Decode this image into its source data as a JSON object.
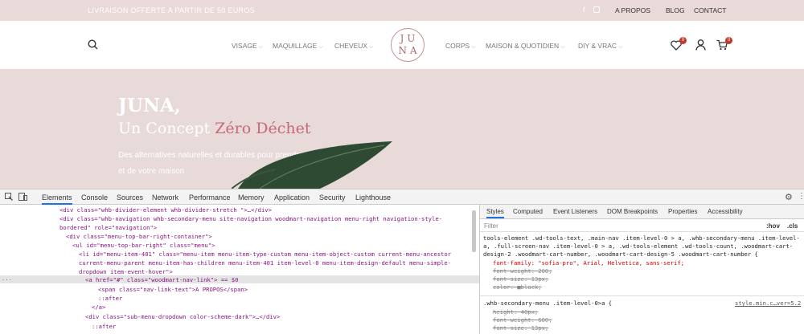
{
  "topbar": {
    "promo": "LIVRAISON OFFERTE A PARTIR DE 50 EUROS",
    "social": [
      "facebook-icon",
      "instagram-icon"
    ],
    "links": [
      "A PROPOS",
      "BLOG",
      "CONTACT"
    ]
  },
  "nav": {
    "left": [
      "VISAGE",
      "MAQUILLAGE",
      "CHEVEUX"
    ],
    "right": [
      "CORPS",
      "MAISON & QUOTIDIEN",
      "DIY & VRAC"
    ],
    "logo_line1": "J U",
    "logo_line2": "N A",
    "wishlist_count": "0",
    "cart_count": "0"
  },
  "hero": {
    "title": "JUNA,",
    "subtitle_a": "Un Concept ",
    "subtitle_b": "Zéro Déchet",
    "line1": "Des alternatives naturelles et durables pour prendre soin de vous",
    "line2": "et de votre maison"
  },
  "devtools": {
    "tabs": [
      "Elements",
      "Console",
      "Sources",
      "Network",
      "Performance",
      "Memory",
      "Application",
      "Security",
      "Lighthouse"
    ],
    "side_tabs": [
      "Styles",
      "Computed",
      "Event Listeners",
      "DOM Breakpoints",
      "Properties",
      "Accessibility"
    ],
    "filter_placeholder": "Filter",
    "hov": ":hov",
    "cls": ".cls",
    "tree": [
      "<div class=\"whb-divider-element whb-divider-stretch \">…</div>",
      "<div class=\"whb-navigation whb-secondary-menu site-navigation woodmart-navigation menu-right navigation-style-",
      "bordered\" role=\"navigation\">",
      "<div class=\"menu-top-bar-right-container\">",
      "<ul id=\"menu-top-bar-right\" class=\"menu\">",
      "<li id=\"menu-item-401\" class=\"menu-item menu-item-type-custom menu-item-object-custom current-menu-ancestor",
      "current-menu-parent menu-item-has-children menu-item-401 item-level-0 menu-item-design-default menu-simple-",
      "dropdown item-event-hover\">",
      "<a href=\"#\" class=\"woodmart-nav-link\"> == $0",
      "<span class=\"nav-link-text\">A PROPOS</span>",
      "::after",
      "</a>",
      "<div class=\"sub-menu-dropdown color-scheme-dark\">…</div>",
      "::after"
    ],
    "rules": {
      "selector1": "tools-element .wd-tools-text, .main-nav .item-level-0 > a, .whb-secondary-menu .item-level-",
      "selector2": "a, .full-screen-nav .item-level-0 > a, .wd-tools-element .wd-tools-count, .woodmart-cart-",
      "selector3": "design-2 .woodmart-cart-number, .woodmart-cart-design-5 .woodmart-cart-number {",
      "decl1": "font-family: \"sofia-pro\", Arial, Helvetica, sans-serif;",
      "decl2": "font-weight: 200;",
      "decl3": "font-size: 13px;",
      "decl4": "color: ■black;",
      "selector4": ".whb-secondary-menu .item-level-0>a {",
      "source": "style.min.c…ver=5.2",
      "decl5": "height: 40px;",
      "decl6": "font-weight: 600;",
      "decl7": "font-size: 13px;"
    }
  }
}
